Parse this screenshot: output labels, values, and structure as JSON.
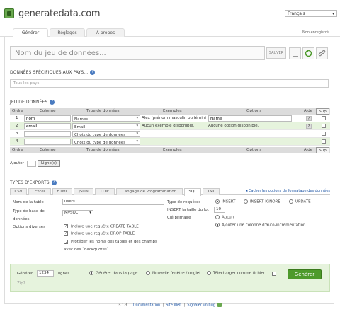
{
  "app": {
    "logo_text": "generatedata.com"
  },
  "language": {
    "selected": "Français"
  },
  "tabs": [
    {
      "label": "Générer",
      "active": true
    },
    {
      "label": "Réglages",
      "active": false
    },
    {
      "label": "A propos",
      "active": false
    }
  ],
  "signed_in": "Non enregistré",
  "dataset_name": {
    "placeholder": "Nom du jeu de données..."
  },
  "toolbar": {
    "save_label": "SAUVER"
  },
  "country_section": {
    "title": "DONNÉES SPÉCIFIQUES AUX PAYS...",
    "placeholder": "Tous les pays"
  },
  "dataset_section": {
    "title": "JEU DE DONNÉES"
  },
  "table": {
    "headers": [
      "Ordre",
      "Colonne",
      "Type de données",
      "Exemples",
      "Options",
      "Aide",
      "Sup"
    ],
    "rows": [
      {
        "order": "1",
        "column": "nom",
        "type": "Names",
        "example": "Alex (prénom masculin ou fémini",
        "options": "Name",
        "help": "?"
      },
      {
        "order": "2",
        "column": "email",
        "type": "Email",
        "example": "Aucun exemple disponible.",
        "options": "Aucune option disponible.",
        "help": "?"
      },
      {
        "order": "3",
        "column": "",
        "type": "Choix du type de données",
        "example": "",
        "options": "",
        "help": ""
      },
      {
        "order": "4",
        "column": "",
        "type": "Choix du type de données",
        "example": "",
        "options": "",
        "help": ""
      }
    ],
    "add_label": "Ajouter",
    "add_button": "Ligne(s)"
  },
  "export_section": {
    "title": "TYPES D'EXPORTS",
    "tabs": [
      "CSV",
      "Excel",
      "HTML",
      "JSON",
      "LDIF",
      "Langage de Programmation",
      "SQL",
      "XML"
    ],
    "active_tab": "SQL",
    "hide_link": "Cacher les options de formatage des données",
    "table_name_label": "Nom de la table",
    "table_name_value": "users",
    "db_type_label": "Type de base de données",
    "db_type_value": "MySQL",
    "options_label": "Options diverses",
    "options": [
      {
        "label": "Inclure une requête CREATE TABLE",
        "checked": true
      },
      {
        "label": "Inclure une requête DROP TABLE",
        "checked": true
      },
      {
        "label": "Protéger les noms des tables et des champs avec des `backquotes`",
        "checked": true
      }
    ],
    "query_type_label": "Type de requêtes",
    "query_types": [
      {
        "label": "INSERT",
        "checked": true
      },
      {
        "label": "INSERT IGNORE",
        "checked": false
      },
      {
        "label": "UPDATE",
        "checked": false
      }
    ],
    "batch_label": "INSERT la taille du lot",
    "batch_value": "10",
    "pk_label": "Clé primaire",
    "pk_options": [
      {
        "label": "Aucun",
        "checked": false
      },
      {
        "label": "Ajouter une colonne d'auto-incrémentation",
        "checked": true
      }
    ]
  },
  "generate": {
    "label": "Générer",
    "count": "1234",
    "lines_label": "lignes",
    "modes": [
      {
        "label": "Générer dans la page",
        "checked": true
      },
      {
        "label": "Nouvelle fenêtre / onglet",
        "checked": false
      },
      {
        "label": "Télécharger comme fichier",
        "checked": false
      }
    ],
    "zip_label": "Zip?",
    "button": "Générer"
  },
  "footer": {
    "version": "3.1.3",
    "links": [
      "Documentation",
      "Site Web",
      "Signaler un bug"
    ]
  }
}
